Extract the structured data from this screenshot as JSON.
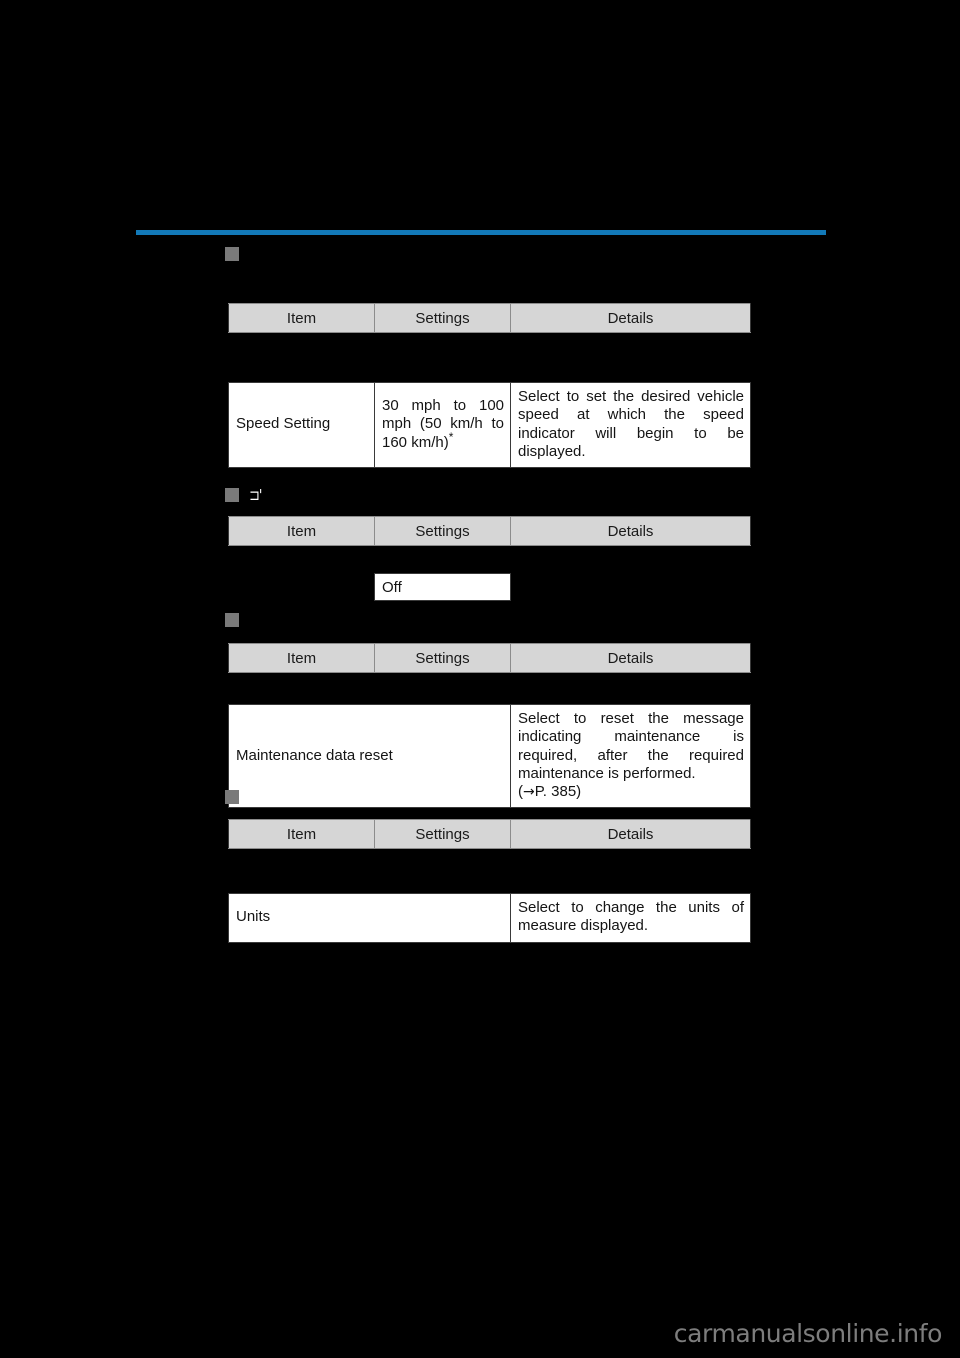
{
  "page": {
    "background_color": "#000000",
    "accent_color": "#1279b8",
    "header_fill": "#d6d6d6",
    "marker_color": "#7a7a7a",
    "watermark": "carmanualsonline.info"
  },
  "columns": {
    "item": "Item",
    "settings": "Settings",
    "details": "Details"
  },
  "sections": [
    {
      "id": "section-1",
      "marker": "square-marker",
      "glyph": "",
      "rows": [
        {
          "item": "Speed Setting",
          "settings": "30 mph to 100 mph (50 km/h to 160 km/h)",
          "settings_footnote": "*",
          "details": "Select to set the desired vehicle speed at which the speed indicator will begin to be displayed."
        }
      ]
    },
    {
      "id": "section-2",
      "marker": "square-marker",
      "glyph": "⊐'",
      "rows": [],
      "value_box": "Off"
    },
    {
      "id": "section-3",
      "marker": "square-marker",
      "glyph": "",
      "rows": [
        {
          "item": "Maintenance data reset",
          "settings": "",
          "details": "Select to reset the message indicating maintenance is required, after the required maintenance is performed.",
          "details_reference_prefix": "(",
          "details_reference_arrow": "→",
          "details_reference": "P. 385",
          "details_reference_suffix": ")"
        }
      ]
    },
    {
      "id": "section-4",
      "marker": "square-marker",
      "glyph": "",
      "rows": [
        {
          "item": "Units",
          "settings": "",
          "details": "Select to change the units of measure displayed."
        }
      ]
    }
  ]
}
